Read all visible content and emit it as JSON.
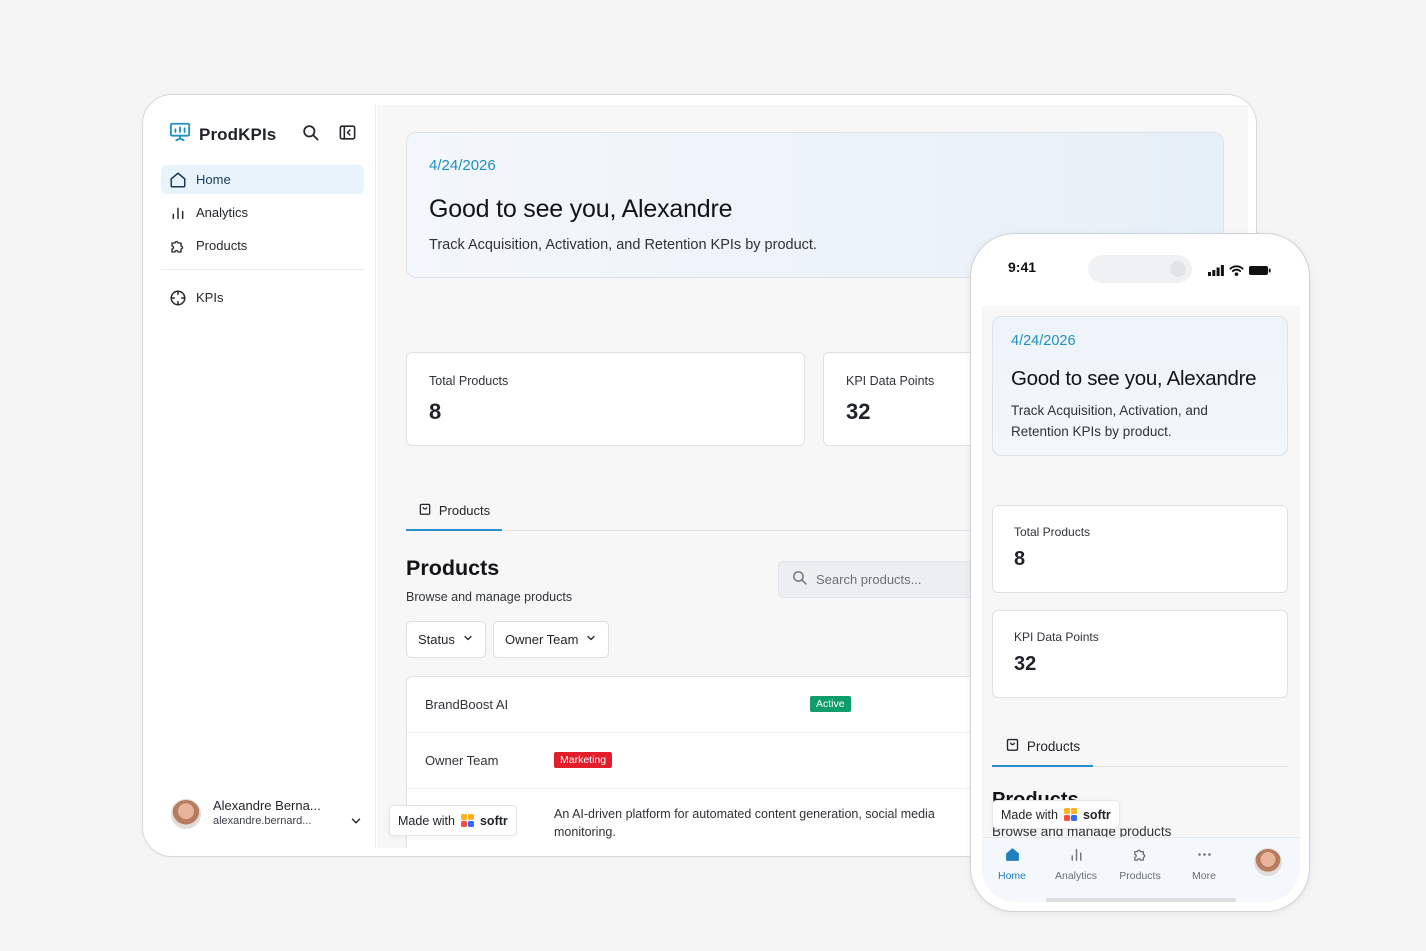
{
  "desktop": {
    "brand": "ProdKPIs",
    "nav": {
      "items": [
        {
          "label": "Home",
          "icon": "home-icon",
          "active": true
        },
        {
          "label": "Analytics",
          "icon": "bar-chart-icon"
        },
        {
          "label": "Products",
          "icon": "puzzle-icon"
        }
      ],
      "secondary": [
        {
          "label": "KPIs",
          "icon": "crosshair-icon"
        }
      ]
    },
    "user": {
      "name": "Alexandre Berna...",
      "email": "alexandre.bernard..."
    },
    "hero": {
      "date": "4/24/2026",
      "title": "Good to see you, Alexandre",
      "subtitle": "Track Acquisition, Activation, and Retention KPIs by product."
    },
    "stats": [
      {
        "label": "Total Products",
        "value": "8"
      },
      {
        "label": "KPI Data Points",
        "value": "32"
      }
    ],
    "tab": "Products",
    "section": {
      "title": "Products",
      "subtitle": "Browse and manage products"
    },
    "search": {
      "placeholder": "Search products..."
    },
    "filters": [
      "Status",
      "Owner Team"
    ],
    "product": {
      "name": "BrandBoost AI",
      "status": "Active",
      "owner_label": "Owner Team",
      "owner_value": "Marketing",
      "description": "An AI-driven platform for automated content generation, social media monitoring."
    },
    "made_with": {
      "prefix": "Made with",
      "brand": "softr"
    }
  },
  "phone": {
    "time": "9:41",
    "hero": {
      "date": "4/24/2026",
      "title": "Good to see you, Alexandre",
      "subtitle": "Track Acquisition, Activation, and Retention KPIs by product."
    },
    "stats": [
      {
        "label": "Total Products",
        "value": "8"
      },
      {
        "label": "KPI Data Points",
        "value": "32"
      }
    ],
    "tab": "Products",
    "section": {
      "title": "Products",
      "subtitle": "Browse and manage products"
    },
    "made_with": {
      "prefix": "Made with",
      "brand": "softr"
    },
    "bottom_nav": [
      {
        "label": "Home",
        "icon": "home-icon",
        "active": true
      },
      {
        "label": "Analytics",
        "icon": "bar-chart-icon"
      },
      {
        "label": "Products",
        "icon": "puzzle-icon"
      },
      {
        "label": "More",
        "icon": "more-dots-icon"
      }
    ]
  },
  "colors": {
    "accent": "#1f8fc4",
    "tab_underline": "#2a8fc7",
    "badge_active": "#0f9d6b",
    "badge_marketing": "#e21e2b"
  }
}
